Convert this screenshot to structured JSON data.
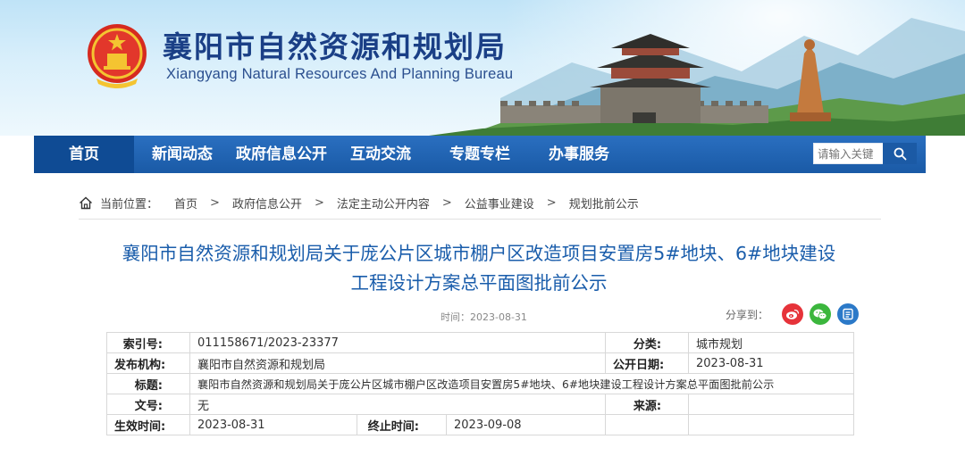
{
  "site": {
    "title": "襄阳市自然资源和规划局",
    "subtitle": "Xiangyang Natural Resources And Planning Bureau"
  },
  "nav": {
    "items": [
      "首页",
      "新闻动态",
      "政府信息公开",
      "互动交流",
      "专题专栏",
      "办事服务"
    ],
    "search_placeholder": "请输入关键"
  },
  "breadcrumb": {
    "label": "当前位置：",
    "items": [
      "首页",
      "政府信息公开",
      "法定主动公开内容",
      "公益事业建设",
      "规划批前公示"
    ]
  },
  "article": {
    "title_line1": "襄阳市自然资源和规划局关于庞公片区城市棚户区改造项目安置房5#地块、6#地块建设",
    "title_line2": "工程设计方案总平面图批前公示",
    "time": "时间：2023-08-31",
    "share_label": "分享到："
  },
  "meta": {
    "index_no_label": "索引号:",
    "index_no": "011158671/2023-23377",
    "category_label": "分类:",
    "category": "城市规划",
    "publisher_label": "发布机构:",
    "publisher": "襄阳市自然资源和规划局",
    "publish_date_label": "公开日期:",
    "publish_date": "2023-08-31",
    "subject_label": "标题:",
    "subject": "襄阳市自然资源和规划局关于庞公片区城市棚户区改造项目安置房5#地块、6#地块建设工程设计方案总平面图批前公示",
    "doc_no_label": "文号:",
    "doc_no": "无",
    "source_label": "来源:",
    "source": "",
    "effective_label": "生效时间:",
    "effective": "2023-08-31",
    "expire_label": "终止时间:",
    "expire": "2023-09-08"
  },
  "colors": {
    "nav_bg": "#1a5aa6",
    "nav_home_bg": "#0f4b94",
    "title_blue": "#1a5dab",
    "site_title": "#1a3f86"
  },
  "icons": [
    "national-emblem-icon",
    "search-icon",
    "home-icon",
    "weibo-icon",
    "wechat-icon",
    "share-other-icon"
  ]
}
